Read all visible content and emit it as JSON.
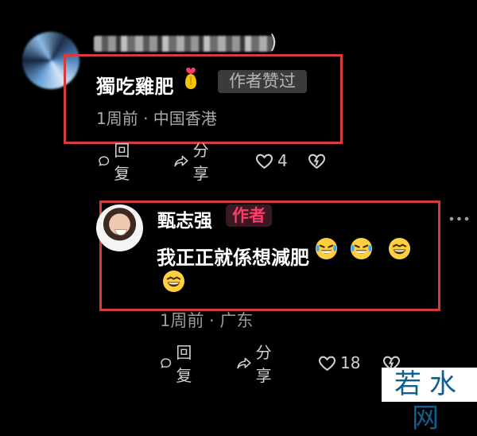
{
  "top_comment": {
    "paren_fragment": ")",
    "username": "獨吃雞肥",
    "author_liked_label": "作者赞过",
    "meta": "1周前 · 中国香港",
    "actions": {
      "reply": "回复",
      "share": "分享",
      "likes": "4"
    }
  },
  "reply_comment": {
    "username": "甄志强",
    "author_badge": "作者",
    "text": "我正正就係想減肥",
    "meta": "1周前 · 广东",
    "actions": {
      "reply": "回复",
      "share": "分享",
      "likes": "18"
    }
  },
  "watermark": {
    "label": "若水网"
  },
  "colors": {
    "highlight_box": "#d63b3b",
    "author_badge_bg": "#3a1821",
    "author_badge_text": "#ff3b67",
    "watermark_text": "#0f5e8e"
  },
  "icons": [
    "gift-icon",
    "reply-icon",
    "share-icon",
    "heart-icon",
    "dislike-icon",
    "more-icon",
    "laughing-emoji-icon",
    "crying-laughing-emoji-icon"
  ]
}
